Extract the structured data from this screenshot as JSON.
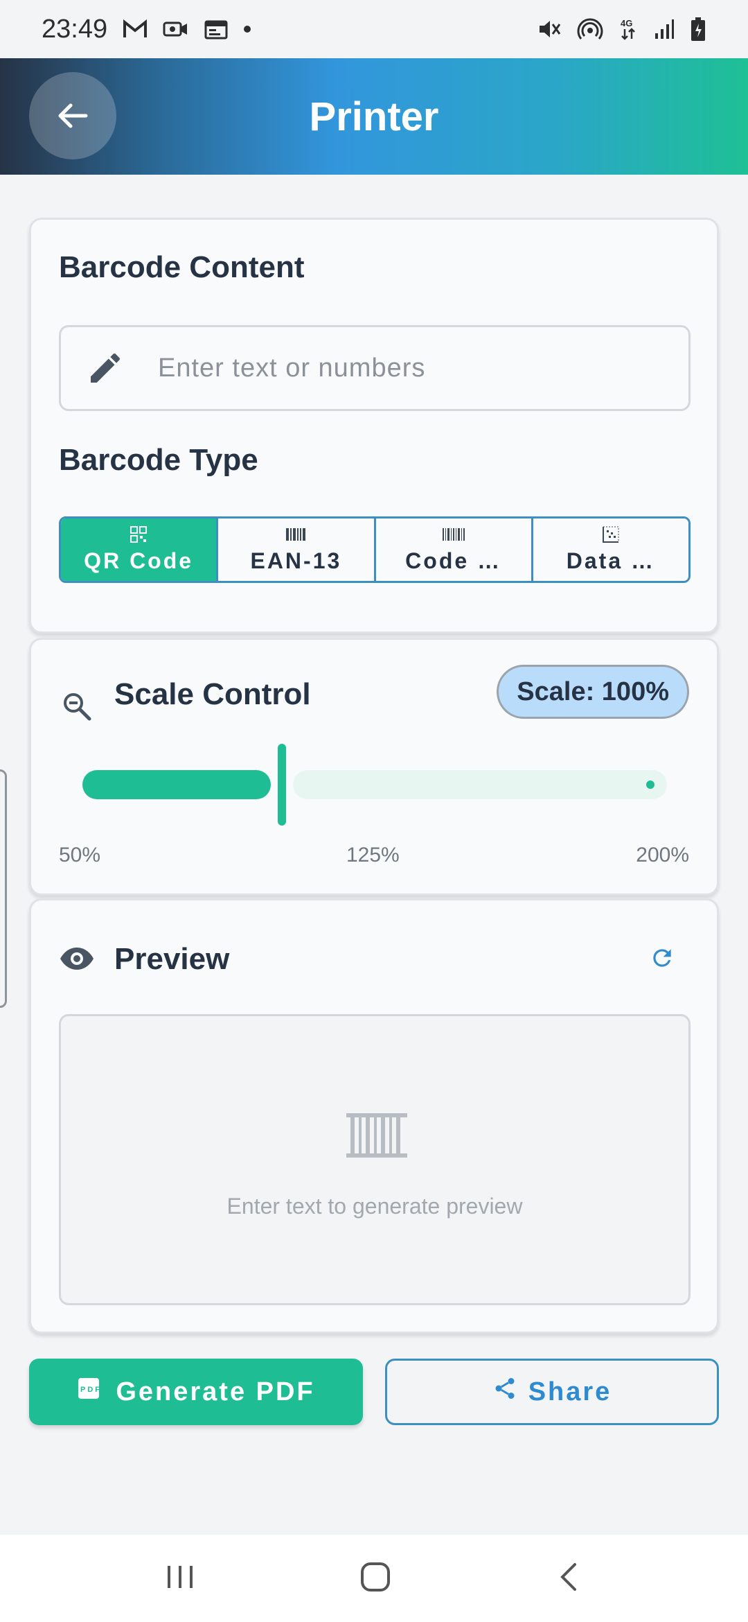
{
  "status_bar": {
    "time": "23:49",
    "network": "4G"
  },
  "header": {
    "title": "Printer"
  },
  "barcode_content": {
    "title": "Barcode Content",
    "input_placeholder": "Enter text or numbers",
    "input_value": ""
  },
  "barcode_type": {
    "title": "Barcode Type",
    "options": [
      {
        "label": "QR Code",
        "icon": "qr-icon",
        "selected": true
      },
      {
        "label": "EAN-13",
        "icon": "barcode-icon",
        "selected": false
      },
      {
        "label": "Code …",
        "icon": "barcode-icon",
        "selected": false
      },
      {
        "label": "Data …",
        "icon": "datamatrix-icon",
        "selected": false
      }
    ]
  },
  "scale_control": {
    "title": "Scale Control",
    "badge": "Scale: 100%",
    "value_percent": 100,
    "min_label": "50%",
    "mid_label": "125%",
    "max_label": "200%"
  },
  "preview": {
    "title": "Preview",
    "empty_hint": "Enter text to generate preview"
  },
  "actions": {
    "generate_pdf": "Generate PDF",
    "share": "Share"
  },
  "colors": {
    "accent_green": "#1fbd94",
    "accent_blue": "#3c8fc0",
    "badge_blue": "#b9dcfb"
  }
}
